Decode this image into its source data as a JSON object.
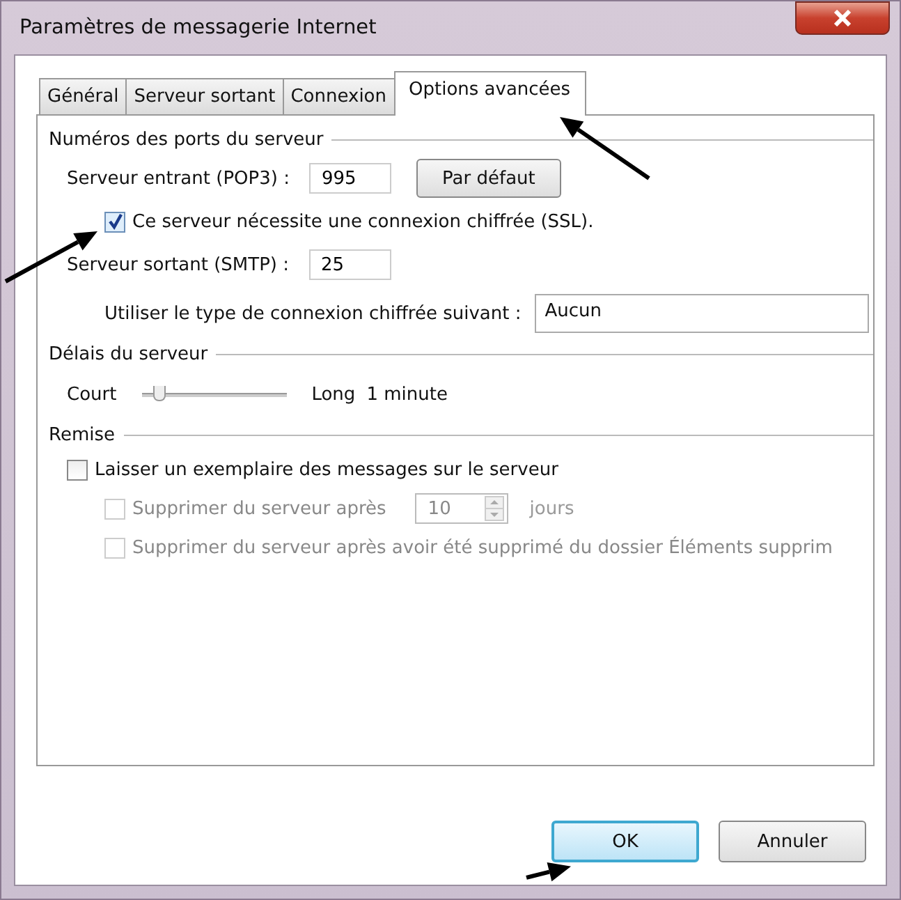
{
  "window": {
    "title": "Paramètres de messagerie Internet"
  },
  "tabs": [
    {
      "label": "Général",
      "selected": false
    },
    {
      "label": "Serveur sortant",
      "selected": false
    },
    {
      "label": "Connexion",
      "selected": false
    },
    {
      "label": "Options avancées",
      "selected": true
    }
  ],
  "ports": {
    "title": "Numéros des ports du serveur",
    "incoming": {
      "label": "Serveur entrant (POP3) :",
      "value": "995",
      "default_button": "Par défaut"
    },
    "ssl": {
      "label": "Ce serveur nécessite une connexion chiffrée (SSL).",
      "checked": true
    },
    "outgoing": {
      "label": "Serveur sortant (SMTP) :",
      "value": "25"
    },
    "encryption": {
      "label": "Utiliser le type de connexion chiffrée suivant :",
      "value": "Aucun"
    }
  },
  "timeouts": {
    "title": "Délais du serveur",
    "min_label": "Court",
    "max_label": "Long",
    "level": 0.08,
    "reading": "1 minute"
  },
  "delivery": {
    "title": "Remise",
    "leave_copy": {
      "label": "Laisser un exemplaire des messages sur le serveur",
      "checked": false,
      "disabled": false
    },
    "remove_after": {
      "label": "Supprimer du serveur après",
      "checked": false,
      "disabled": true,
      "value": "10",
      "unit": "jours"
    },
    "remove_deleted": {
      "label": "Supprimer du serveur après avoir été supprimé du dossier Éléments supprim",
      "checked": false,
      "disabled": true
    }
  },
  "buttons": [
    {
      "label": "OK",
      "default": true
    },
    {
      "label": "Annuler",
      "default": false
    }
  ]
}
